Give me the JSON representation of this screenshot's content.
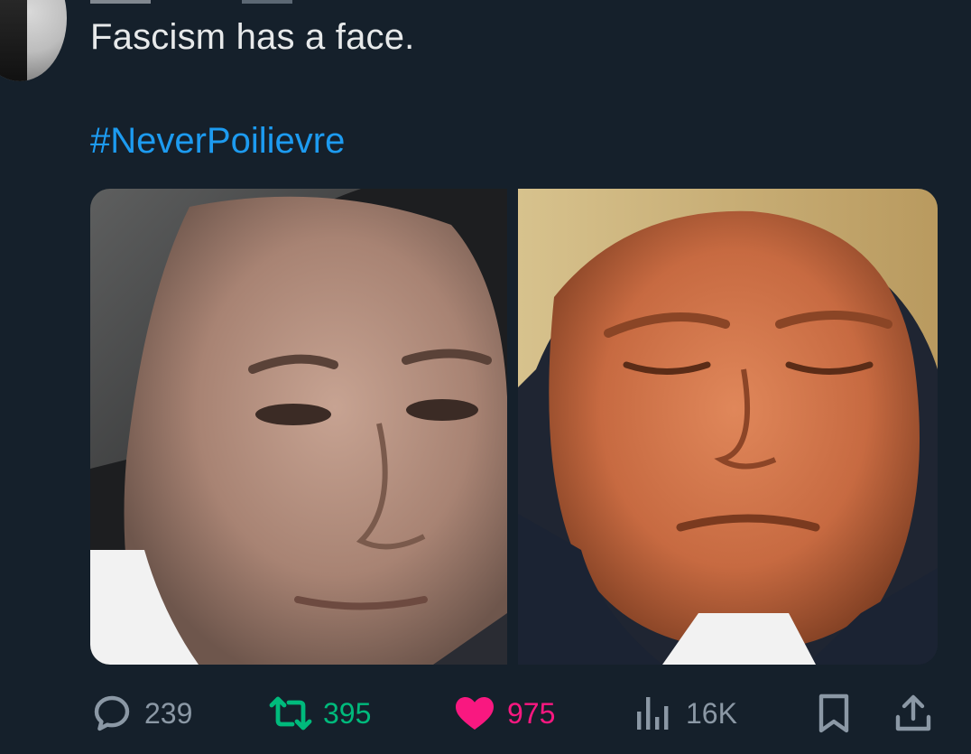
{
  "tweet": {
    "text": "Fascism has a face.",
    "hashtag": "#NeverPoilievre"
  },
  "actions": {
    "replies": "239",
    "retweets": "395",
    "likes": "975",
    "views": "16K"
  },
  "colors": {
    "background": "#15202b",
    "text": "#e7e9ea",
    "link": "#1d9bf0",
    "muted": "#8b98a5",
    "retweet": "#00ba7c",
    "like": "#f91880"
  },
  "icons": {
    "reply": "reply-icon",
    "retweet": "retweet-icon",
    "like": "heart-icon",
    "views": "views-icon",
    "bookmark": "bookmark-icon",
    "share": "share-icon"
  },
  "state": {
    "retweeted": true,
    "liked": true
  }
}
